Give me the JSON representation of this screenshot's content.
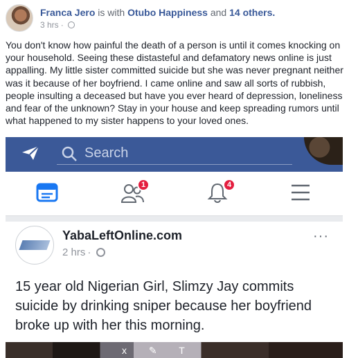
{
  "post": {
    "author": "Franca Jero",
    "with_text": "is with",
    "tagged": "Otubo Happiness",
    "and_text": "and",
    "others": "14 others.",
    "time": "3 hrs",
    "dot": "·",
    "body": "You don't know how painful the death of a person is until it comes knocking on your household. Seeing these distasteful and defamatory news online is just appalling. My little sister committed suicide but she was never pregnant neither was it because of her boyfriend. I came online and saw all sorts of rubbish, people insulting a deceased but have you ever heard of depression, loneliness and fear of the unknown? Stay in your house and keep spreading rumors until what happened to my sister happens to your loved ones."
  },
  "screenshot": {
    "search_placeholder": "Search",
    "friend_requests_badge": "1",
    "notifications_badge": "4",
    "page_name": "YabaLeftOnline.com",
    "page_time": "2 hrs",
    "page_dot": "·",
    "more": "···",
    "headline": "15 year old Nigerian Girl, Slimzy Jay commits suicide by drinking sniper because her boyfriend broke up with her this morning.",
    "photo_overlay": "x ✎ T"
  },
  "colors": {
    "brand": "#3b5998",
    "link": "#385898",
    "badge": "#e41e3f"
  }
}
